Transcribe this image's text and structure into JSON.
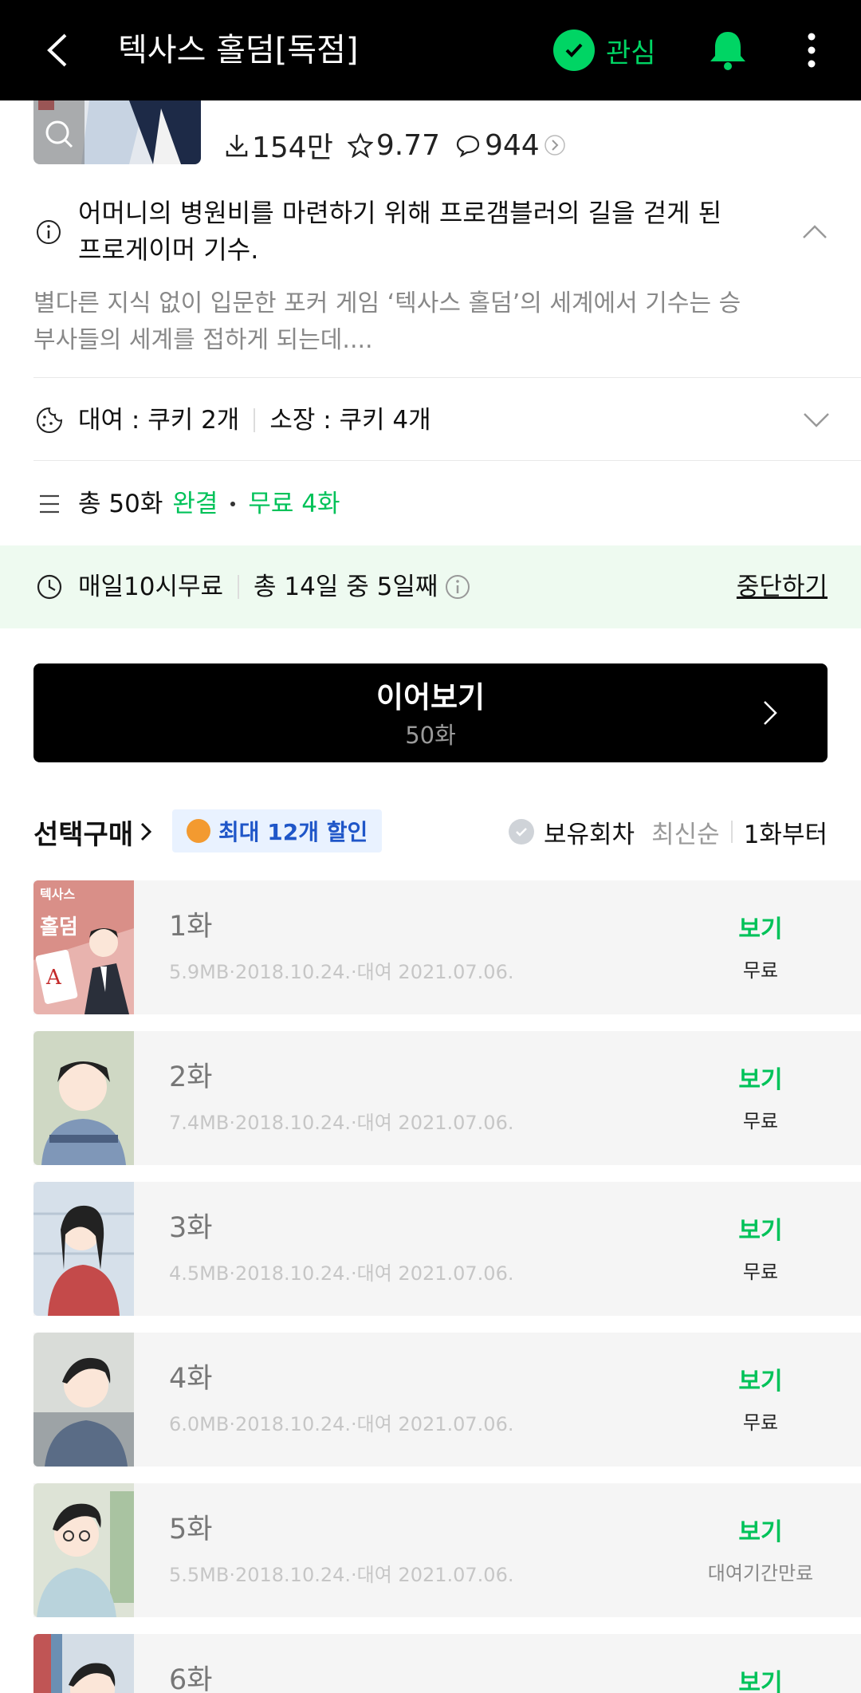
{
  "topbar": {
    "title": "텍사스 홀덤[독점]",
    "favorite_label": "관심"
  },
  "stats": {
    "downloads": "154만",
    "rating": "9.77",
    "comments": "944"
  },
  "synopsis": {
    "title": "어머니의 병원비를 마련하기 위해 프로갬블러의 길을 걷게 된 프로게이머 기수.",
    "description": "별다른 지식 없이 입문한 포커 게임 ‘텍사스 홀덤’의 세계에서 기수는 승부사들의 세계를 접하게 되는데...."
  },
  "rental": {
    "rent": "대여 : 쿠키 2개",
    "own": "소장 : 쿠키 4개"
  },
  "episodes_summary": {
    "total": "총 50화",
    "complete": "완결",
    "free": "무료 4화"
  },
  "banner": {
    "daily_free": "매일10시무료",
    "progress": "총 14일 중 5일째",
    "stop_label": "중단하기"
  },
  "continue": {
    "label": "이어보기",
    "episode": "50화"
  },
  "purchase": {
    "select_label": "선택구매",
    "promo": "최대 12개 할인",
    "owned_label": "보유회차",
    "sort_latest": "최신순",
    "sort_first": "1화부터"
  },
  "episodes": [
    {
      "title": "1화",
      "meta": "5.9MB·2018.10.24.·대여 2021.07.06.",
      "view": "보기",
      "price": "무료"
    },
    {
      "title": "2화",
      "meta": "7.4MB·2018.10.24.·대여 2021.07.06.",
      "view": "보기",
      "price": "무료"
    },
    {
      "title": "3화",
      "meta": "4.5MB·2018.10.24.·대여 2021.07.06.",
      "view": "보기",
      "price": "무료"
    },
    {
      "title": "4화",
      "meta": "6.0MB·2018.10.24.·대여 2021.07.06.",
      "view": "보기",
      "price": "무료"
    },
    {
      "title": "5화",
      "meta": "5.5MB·2018.10.24.·대여 2021.07.06.",
      "view": "보기",
      "price": "대여기간만료"
    },
    {
      "title": "6화",
      "meta": "",
      "view": "보기",
      "price": ""
    }
  ],
  "cover_text": {
    "line1": "텍사스",
    "line2": "홀덤"
  },
  "colors": {
    "accent": "#00c259",
    "banner_bg": "#eefaf0",
    "promo_text": "#1f56c8"
  }
}
